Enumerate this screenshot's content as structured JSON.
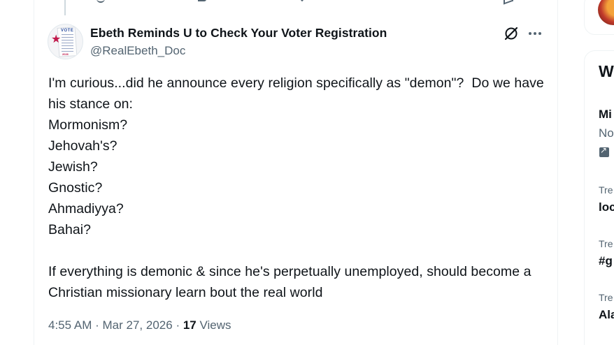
{
  "tweet": {
    "display_name": "Ebeth Reminds U to Check Your Voter Registration",
    "handle": "@RealEbeth_Doc",
    "text": "I'm curious...did he announce every religion specifically as \"demon\"?  Do we have his stance on:\nMormonism?\nJehovah's?\nJewish?\nGnostic?\nAhmadiyya?\nBahai?\n\nIf everything is demonic & since he's perpetually unemployed, should become a Christian missionary learn bout the real world",
    "time": "4:55 AM",
    "date": "Mar 27, 2026",
    "views_count": "17",
    "views_label": "Views",
    "separator": "·"
  },
  "avatar": {
    "vote_text": "VOTE",
    "bottom_text": "2026"
  },
  "sidebar": {
    "heading": "W",
    "news_title": "Mi",
    "news_subtitle": "No",
    "trends": [
      {
        "label": "Tre",
        "name": "loc"
      },
      {
        "label": "Tre",
        "name": "#g"
      },
      {
        "label": "Tre",
        "name": "Ala"
      }
    ]
  },
  "icons": {
    "grok": "grok-icon",
    "more": "more-icon",
    "external": "external-link-icon"
  }
}
